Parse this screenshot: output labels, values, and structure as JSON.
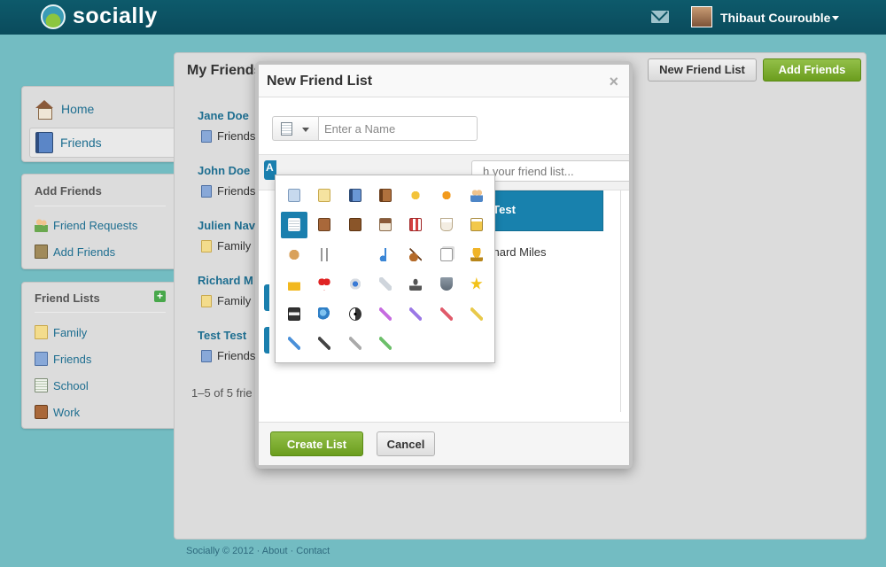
{
  "header": {
    "logo_text": "socially",
    "user_name": "Thibaut Courouble",
    "icons": {
      "mail": "mail-icon",
      "avatar": "user-avatar",
      "menu": "caret-down-icon"
    }
  },
  "sidebar": {
    "nav": [
      {
        "label": "Home",
        "icon": "house-icon",
        "active": false
      },
      {
        "label": "Friends",
        "icon": "address-book-icon",
        "active": true
      }
    ],
    "add_friends": {
      "title": "Add Friends",
      "links": [
        {
          "label": "Friend Requests",
          "icon": "people-icon"
        },
        {
          "label": "Add Friends",
          "icon": "address-book-add-icon"
        }
      ]
    },
    "friend_lists": {
      "title": "Friend Lists",
      "add_button": "+",
      "items": [
        {
          "label": "Family",
          "icon": "yellow-notebook-icon"
        },
        {
          "label": "Friends",
          "icon": "blue-notebook-icon"
        },
        {
          "label": "School",
          "icon": "lined-notebook-icon"
        },
        {
          "label": "Work",
          "icon": "briefcase-icon"
        }
      ]
    }
  },
  "main": {
    "title": "My Friends",
    "buttons": {
      "new_list": "New Friend List",
      "add_friends": "Add Friends"
    },
    "friends": [
      {
        "name": "Jane Doe",
        "list": "Friends",
        "list_color": "blue"
      },
      {
        "name": "John Doe",
        "list": "Friends",
        "list_color": "blue"
      },
      {
        "name": "Julien Nav",
        "list": "Family",
        "list_color": "yellow"
      },
      {
        "name": "Richard M",
        "list": "Family",
        "list_color": "yellow"
      },
      {
        "name": "Test Test",
        "list": "Friends",
        "list_color": "blue"
      }
    ],
    "pager": "1–5 of 5 frie"
  },
  "footer": {
    "text": "Socially © 2012 · About · Contact"
  },
  "modal": {
    "title": "New Friend List",
    "close": "×",
    "name_placeholder": "Enter a Name",
    "search_placeholder": "h your friend list...",
    "selected_friend": "st Test",
    "list_friend": "chard Miles",
    "strip_tab_letter": "A",
    "create_label": "Create List",
    "cancel_label": "Cancel",
    "icons": [
      "blank-document-icon",
      "yellow-note-icon",
      "blue-book-icon",
      "brown-book-icon",
      "yellow-flower-icon",
      "orange-flower-icon",
      "people-group-icon",
      "lined-notebook-icon",
      "briefcase-icon",
      "brown-bag-icon",
      "house-icon",
      "store-icon",
      "coffee-cup-icon",
      "beer-mug-icon",
      "cookie-icon",
      "fork-knife-icon",
      "party-hat-icon",
      "music-note-icon",
      "guitar-icon",
      "playing-cards-icon",
      "trophy-icon",
      "crown-icon",
      "heart-icon",
      "robot-icon",
      "rocket-icon",
      "stamp-icon",
      "shield-icon",
      "star-icon",
      "floppy-disk-icon",
      "globe-icon",
      "yin-yang-icon",
      "purple-tag-icon",
      "violet-tag-icon",
      "red-tag-icon",
      "yellow-tag-icon",
      "blue-tag-icon",
      "black-tag-icon",
      "grey-tag-icon",
      "green-tag-icon"
    ],
    "selected_icon_index": 7
  }
}
